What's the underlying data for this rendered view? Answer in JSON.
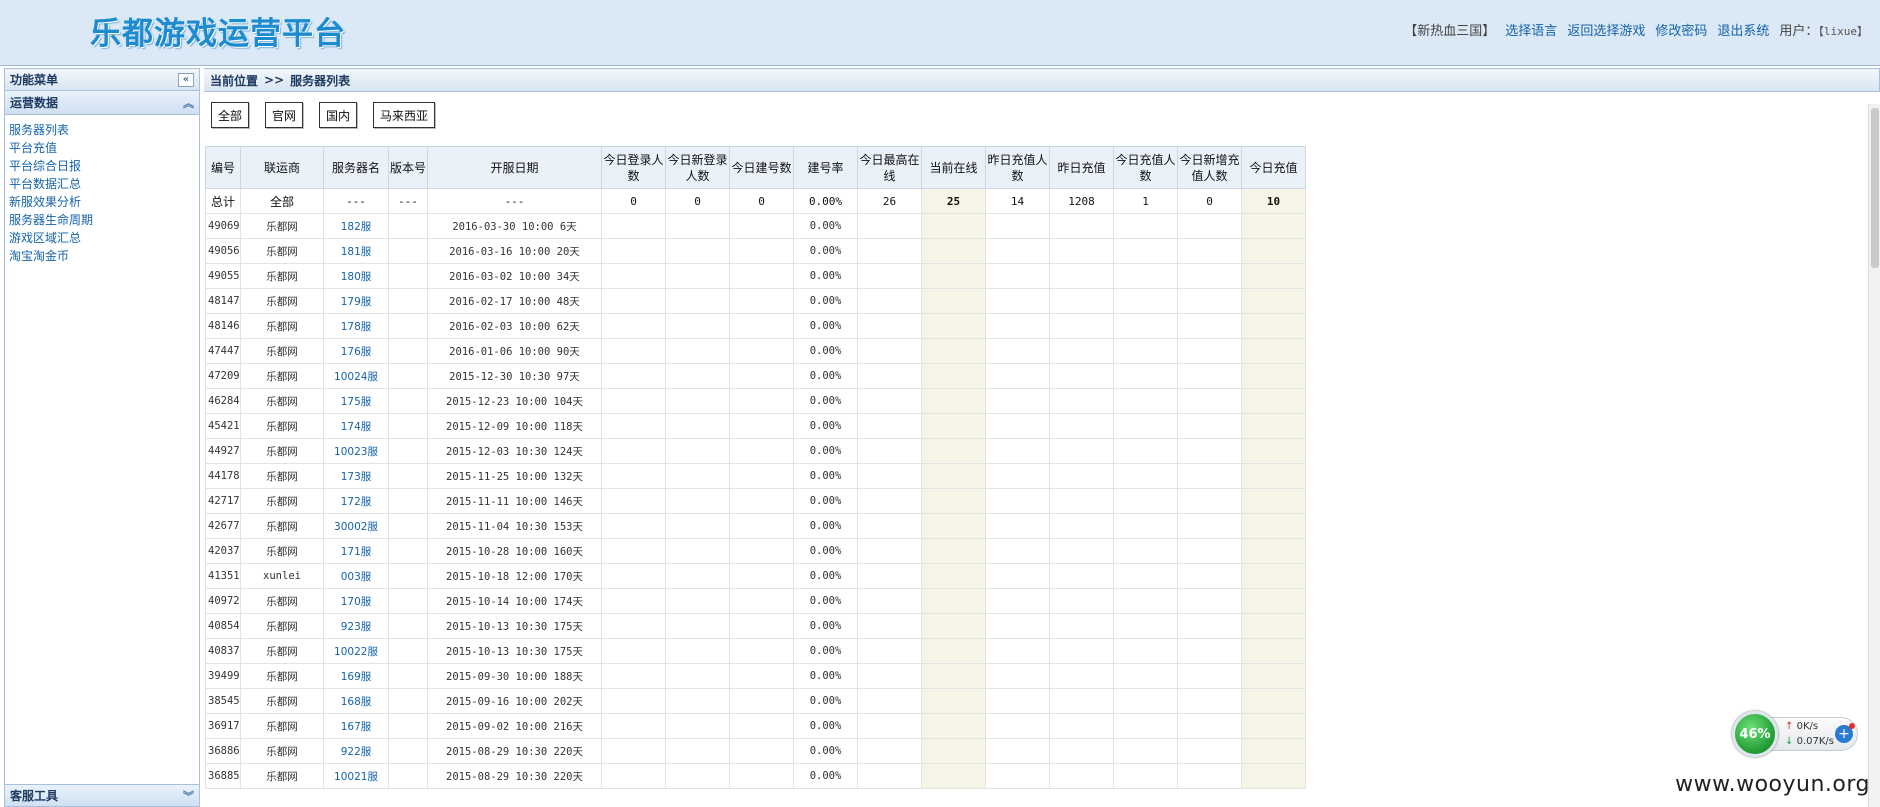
{
  "header": {
    "logo": "乐都游戏运营平台",
    "game": "【新热血三国】",
    "nav": [
      "选择语言",
      "返回选择游戏",
      "修改密码",
      "退出系统"
    ],
    "user_label": "用户：",
    "user_name": "【lixue】"
  },
  "sidebar": {
    "title": "功能菜单",
    "collapse_icon": "double-chevron-left",
    "group_title": "运营数据",
    "items": [
      "服务器列表",
      "平台充值",
      "平台综合日报",
      "平台数据汇总",
      "新服效果分析",
      "服务器生命周期",
      "游戏区域汇总",
      "淘宝淘金币"
    ],
    "bottom_group": "客服工具"
  },
  "breadcrumb": {
    "label": "当前位置",
    "sep": ">>",
    "page": "服务器列表"
  },
  "filters": [
    "全部",
    "官网",
    "国内",
    "马来西亚"
  ],
  "table": {
    "columns": [
      "编号",
      "联运商",
      "服务器名",
      "版本号",
      "开服日期",
      "今日登录人数",
      "今日新登录人数",
      "今日建号数",
      "建号率",
      "今日最高在线",
      "当前在线",
      "昨日充值人数",
      "昨日充值",
      "今日充值人数",
      "今日新增充值人数",
      "今日充值"
    ],
    "total": [
      "总计",
      "全部",
      "---",
      "---",
      "---",
      "0",
      "0",
      "0",
      "0.00%",
      "26",
      "25",
      "14",
      "1208",
      "1",
      "0",
      "10"
    ],
    "rows": [
      {
        "id": "49069",
        "agent": "乐都网",
        "server": "182服",
        "date": "2016-03-30 10:00",
        "days": "6天",
        "rate": "0.00%"
      },
      {
        "id": "49056",
        "agent": "乐都网",
        "server": "181服",
        "date": "2016-03-16 10:00",
        "days": "20天",
        "rate": "0.00%"
      },
      {
        "id": "49055",
        "agent": "乐都网",
        "server": "180服",
        "date": "2016-03-02 10:00",
        "days": "34天",
        "rate": "0.00%"
      },
      {
        "id": "48147",
        "agent": "乐都网",
        "server": "179服",
        "date": "2016-02-17 10:00",
        "days": "48天",
        "rate": "0.00%"
      },
      {
        "id": "48146",
        "agent": "乐都网",
        "server": "178服",
        "date": "2016-02-03 10:00",
        "days": "62天",
        "rate": "0.00%"
      },
      {
        "id": "47447",
        "agent": "乐都网",
        "server": "176服",
        "date": "2016-01-06 10:00",
        "days": "90天",
        "rate": "0.00%"
      },
      {
        "id": "47209",
        "agent": "乐都网",
        "server": "10024服",
        "date": "2015-12-30 10:30",
        "days": "97天",
        "rate": "0.00%"
      },
      {
        "id": "46284",
        "agent": "乐都网",
        "server": "175服",
        "date": "2015-12-23 10:00",
        "days": "104天",
        "rate": "0.00%"
      },
      {
        "id": "45421",
        "agent": "乐都网",
        "server": "174服",
        "date": "2015-12-09 10:00",
        "days": "118天",
        "rate": "0.00%"
      },
      {
        "id": "44927",
        "agent": "乐都网",
        "server": "10023服",
        "date": "2015-12-03 10:30",
        "days": "124天",
        "rate": "0.00%"
      },
      {
        "id": "44178",
        "agent": "乐都网",
        "server": "173服",
        "date": "2015-11-25 10:00",
        "days": "132天",
        "rate": "0.00%"
      },
      {
        "id": "42717",
        "agent": "乐都网",
        "server": "172服",
        "date": "2015-11-11 10:00",
        "days": "146天",
        "rate": "0.00%"
      },
      {
        "id": "42677",
        "agent": "乐都网",
        "server": "30002服",
        "date": "2015-11-04 10:30",
        "days": "153天",
        "rate": "0.00%"
      },
      {
        "id": "42037",
        "agent": "乐都网",
        "server": "171服",
        "date": "2015-10-28 10:00",
        "days": "160天",
        "rate": "0.00%"
      },
      {
        "id": "41351",
        "agent": "xunlei",
        "server": "003服",
        "date": "2015-10-18 12:00",
        "days": "170天",
        "rate": "0.00%"
      },
      {
        "id": "40972",
        "agent": "乐都网",
        "server": "170服",
        "date": "2015-10-14 10:00",
        "days": "174天",
        "rate": "0.00%"
      },
      {
        "id": "40854",
        "agent": "乐都网",
        "server": "923服",
        "date": "2015-10-13 10:30",
        "days": "175天",
        "rate": "0.00%"
      },
      {
        "id": "40837",
        "agent": "乐都网",
        "server": "10022服",
        "date": "2015-10-13 10:30",
        "days": "175天",
        "rate": "0.00%"
      },
      {
        "id": "39499",
        "agent": "乐都网",
        "server": "169服",
        "date": "2015-09-30 10:00",
        "days": "188天",
        "rate": "0.00%"
      },
      {
        "id": "38545",
        "agent": "乐都网",
        "server": "168服",
        "date": "2015-09-16 10:00",
        "days": "202天",
        "rate": "0.00%"
      },
      {
        "id": "36917",
        "agent": "乐都网",
        "server": "167服",
        "date": "2015-09-02 10:00",
        "days": "216天",
        "rate": "0.00%"
      },
      {
        "id": "36886",
        "agent": "乐都网",
        "server": "922服",
        "date": "2015-08-29 10:30",
        "days": "220天",
        "rate": "0.00%"
      },
      {
        "id": "36885",
        "agent": "乐都网",
        "server": "10021服",
        "date": "2015-08-29 10:30",
        "days": "220天",
        "rate": "0.00%"
      }
    ]
  },
  "net_widget": {
    "percent": "46%",
    "up": "0K/s",
    "down": "0.07K/s"
  },
  "watermark": "www.wooyun.org",
  "colors": {
    "header_bg": "#dbe8f6",
    "link": "#1463a8",
    "highlight_col": "#f6f4e6",
    "green_value": "#2a8a2a"
  }
}
